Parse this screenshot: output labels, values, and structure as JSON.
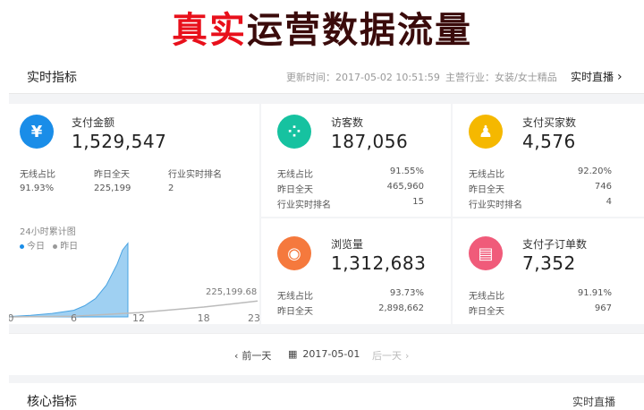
{
  "banner": {
    "part1": "真实",
    "part2": "运营数据流量"
  },
  "header": {
    "title": "实时指标",
    "update_time": "更新时间：2017-05-02 10:51:59",
    "industry": "主营行业：女装/女士精品",
    "live_label": "实时直播",
    "live_chevron": "›"
  },
  "colors": {
    "pay_icon": "#1a8de8",
    "visitor_icon": "#16c2a0",
    "buyer_icon": "#f5b800",
    "pageview_icon": "#f5793d",
    "order_icon": "#f05b7a",
    "chart_fill": "#9fd0f2",
    "chart_line": "#4aa4e3"
  },
  "cards": {
    "pay": {
      "icon": "yen-icon",
      "glyph": "¥",
      "label": "支付金额",
      "value": "1,529,547",
      "stat_labels": [
        "无线占比",
        "昨日全天",
        "行业实时排名"
      ],
      "stat_values": [
        "91.93%",
        "225,199",
        "2"
      ]
    },
    "visitors": {
      "icon": "footprint-icon",
      "glyph": "⁘",
      "label": "访客数",
      "value": "187,056",
      "stats": [
        {
          "label": "无线占比",
          "value": "91.55%"
        },
        {
          "label": "昨日全天",
          "value": "465,960"
        },
        {
          "label": "行业实时排名",
          "value": "15"
        }
      ]
    },
    "buyers": {
      "icon": "users-icon",
      "glyph": "♟",
      "label": "支付买家数",
      "value": "4,576",
      "stats": [
        {
          "label": "无线占比",
          "value": "92.20%"
        },
        {
          "label": "昨日全天",
          "value": "746"
        },
        {
          "label": "行业实时排名",
          "value": "4"
        }
      ]
    },
    "pageviews": {
      "icon": "eye-icon",
      "glyph": "◉",
      "label": "浏览量",
      "value": "1,312,683",
      "stats": [
        {
          "label": "无线占比",
          "value": "93.73%"
        },
        {
          "label": "昨日全天",
          "value": "2,898,662"
        }
      ]
    },
    "orders": {
      "icon": "document-icon",
      "glyph": "▤",
      "label": "支付子订单数",
      "value": "7,352",
      "stats": [
        {
          "label": "无线占比",
          "value": "91.91%"
        },
        {
          "label": "昨日全天",
          "value": "967"
        }
      ]
    }
  },
  "chart_data": {
    "type": "area",
    "title": "24小时累计图",
    "legend": [
      "今日",
      "昨日"
    ],
    "x_ticks": [
      "0",
      "6",
      "12",
      "18",
      "23"
    ],
    "end_label": "225,199.68",
    "series": [
      {
        "name": "今日",
        "x": [
          0,
          2,
          4,
          6,
          7,
          8,
          9,
          10,
          10.5,
          11
        ],
        "y": [
          5000,
          22000,
          50000,
          95000,
          160000,
          260000,
          450000,
          750000,
          950000,
          1050000
        ]
      },
      {
        "name": "昨日",
        "x": [
          0,
          6,
          12,
          18,
          23
        ],
        "y": [
          0,
          10000,
          60000,
          140000,
          225199.68
        ]
      }
    ],
    "xlim": [
      0,
      23
    ],
    "ylim": [
      0,
      1250000
    ]
  },
  "date_nav": {
    "prev": "前一天",
    "date": "2017-05-01",
    "next": "后一天"
  },
  "core": {
    "title": "核心指标",
    "right": "实时直播"
  }
}
